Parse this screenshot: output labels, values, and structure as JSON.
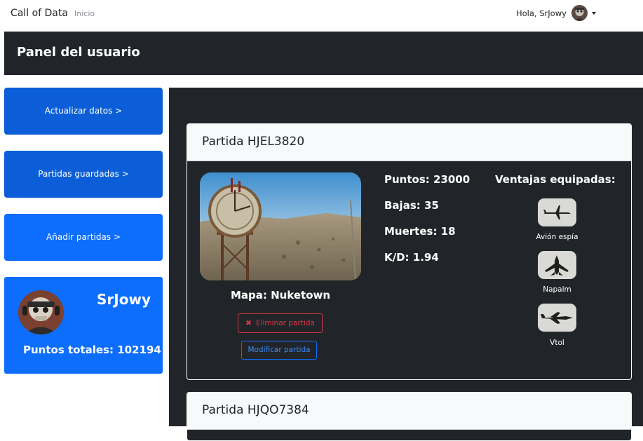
{
  "navbar": {
    "brand": "Call of Data",
    "links": [
      {
        "label": "Inicio"
      }
    ],
    "greeting": "Hola, SrJowy"
  },
  "header": {
    "title": "Panel del usuario"
  },
  "sidebar": {
    "buttons": [
      {
        "label": "Actualizar datos >"
      },
      {
        "label": "Partidas guardadas >"
      },
      {
        "label": "Añadir partidas >"
      }
    ]
  },
  "user": {
    "name": "SrJowy",
    "points_text": "Puntos totales: 102194"
  },
  "matches": [
    {
      "title": "Partida HJEL3820",
      "map_text": "Mapa: Nuketown",
      "delete_label": "Eliminar partida",
      "edit_label": "Modificar partida",
      "stats": {
        "points": "Puntos: 23000",
        "kills": "Bajas: 35",
        "deaths": "Muertes: 18",
        "kd": "K/D: 1.94"
      },
      "perks_title": "Ventajas equipadas:",
      "perks": [
        {
          "label": "Avión espía",
          "icon": "spy-plane-icon"
        },
        {
          "label": "Napalm",
          "icon": "napalm-jet-icon"
        },
        {
          "label": "Vtol",
          "icon": "vtol-icon"
        }
      ]
    },
    {
      "title": "Partida HJQO7384"
    }
  ],
  "colors": {
    "primary": "#0d6efd",
    "primary_dark": "#0b5ed7",
    "dark": "#212529",
    "danger": "#dc3545",
    "light": "#f8f9fa"
  }
}
